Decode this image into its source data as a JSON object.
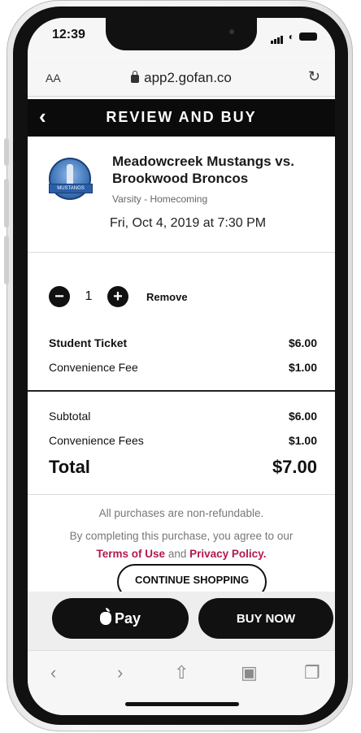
{
  "status": {
    "time": "12:39"
  },
  "browser": {
    "aa": "AA",
    "url": "app2.gofan.co",
    "reload_icon": "reload-icon"
  },
  "header": {
    "title": "REVIEW AND BUY"
  },
  "event": {
    "title": "Meadowcreek Mustangs vs. Brookwood Broncos",
    "subtitle": "Varsity - Homecoming",
    "date": "Fri, Oct 4, 2019 at 7:30 PM",
    "logo_text": "MUSTANGS"
  },
  "ticket": {
    "quantity": "1",
    "remove_label": "Remove",
    "name": "Student Ticket",
    "price": "$6.00",
    "fee_label": "Convenience Fee",
    "fee": "$1.00"
  },
  "summary": {
    "subtotal_label": "Subtotal",
    "subtotal": "$6.00",
    "fees_label": "Convenience Fees",
    "fees": "$1.00",
    "total_label": "Total",
    "total": "$7.00"
  },
  "notice": {
    "refund": "All purchases are non-refundable.",
    "agree": "By completing this purchase, you agree to our",
    "terms": "Terms of Use",
    "and": "and",
    "privacy": "Privacy Policy",
    "period": "."
  },
  "actions": {
    "continue": "CONTINUE SHOPPING",
    "apple_pay": "Pay",
    "buy_now": "BUY NOW"
  },
  "colors": {
    "link": "#b4184e",
    "dark": "#111111"
  }
}
